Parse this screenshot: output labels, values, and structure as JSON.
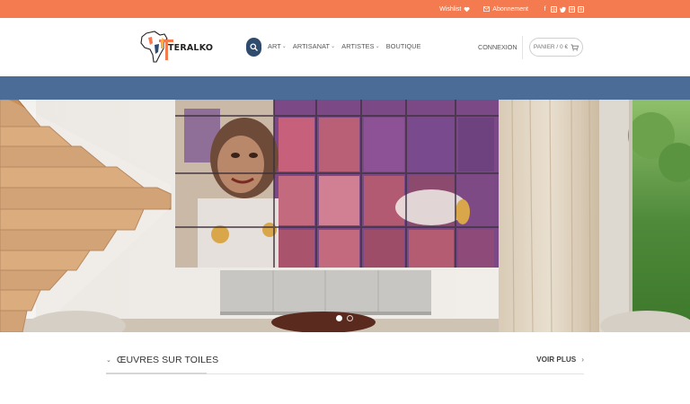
{
  "topbar": {
    "wishlist_label": "Wishlist",
    "subscribe_label": "Abonnement",
    "socials": [
      "facebook-icon",
      "instagram-icon",
      "twitter-icon",
      "email-icon",
      "linkedin-icon"
    ],
    "color": "#f47b4f"
  },
  "header": {
    "logo_text": "TERALKO",
    "nav": [
      {
        "label": "ART",
        "has_dropdown": true
      },
      {
        "label": "ARTISANAT",
        "has_dropdown": true
      },
      {
        "label": "ARTISTES",
        "has_dropdown": true
      },
      {
        "label": "BOUTIQUE",
        "has_dropdown": false
      }
    ],
    "login_label": "CONNEXION",
    "cart_label": "PANIER / 0 €",
    "search_color": "#2f4b6e"
  },
  "band_color": "#4b6c97",
  "hero": {
    "slides_count": 2,
    "active_slide": 1
  },
  "section": {
    "title": "ŒUVRES SUR TOILES",
    "see_more": "VOIR PLUS"
  }
}
